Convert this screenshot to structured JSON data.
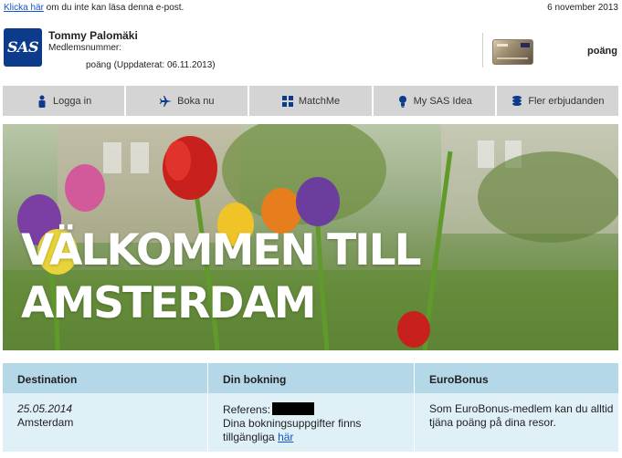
{
  "topbar": {
    "link_text": "Klicka här",
    "rest_text": " om du inte kan läsa denna e-post.",
    "date": "6 november 2013"
  },
  "header": {
    "logo_text": "SAS",
    "member_name": "Tommy Palomäki",
    "member_label": "Medlemsnummer:",
    "points_line": "poäng (Uppdaterat: 06.11.2013)",
    "points_right": "poäng"
  },
  "nav": [
    {
      "label": "Logga in",
      "icon": "person-icon"
    },
    {
      "label": "Boka nu",
      "icon": "airplane-icon"
    },
    {
      "label": "MatchMe",
      "icon": "grid-icon"
    },
    {
      "label": "My SAS Idea",
      "icon": "lightbulb-icon"
    },
    {
      "label": "Fler erbjudanden",
      "icon": "coins-icon"
    }
  ],
  "hero": {
    "line1": "VÄLKOMMEN TILL",
    "line2": "AMSTERDAM"
  },
  "table": {
    "headers": [
      "Destination",
      "Din bokning",
      "EuroBonus"
    ],
    "date": "25.05.2014",
    "city": "Amsterdam",
    "ref_label": "Referens:",
    "booking_text": "Dina bokningsuppgifter finns tillgängliga",
    "booking_link": "här",
    "eurobonus_text": "Som EuroBonus-medlem kan du alltid tjäna poäng på dina resor."
  },
  "colors": {
    "nav_bg": "#d4d4d4",
    "nav_icon": "#0d3b8c",
    "table_header": "#b5d8e8",
    "table_body": "#dff0f7",
    "link": "#1155cc"
  }
}
